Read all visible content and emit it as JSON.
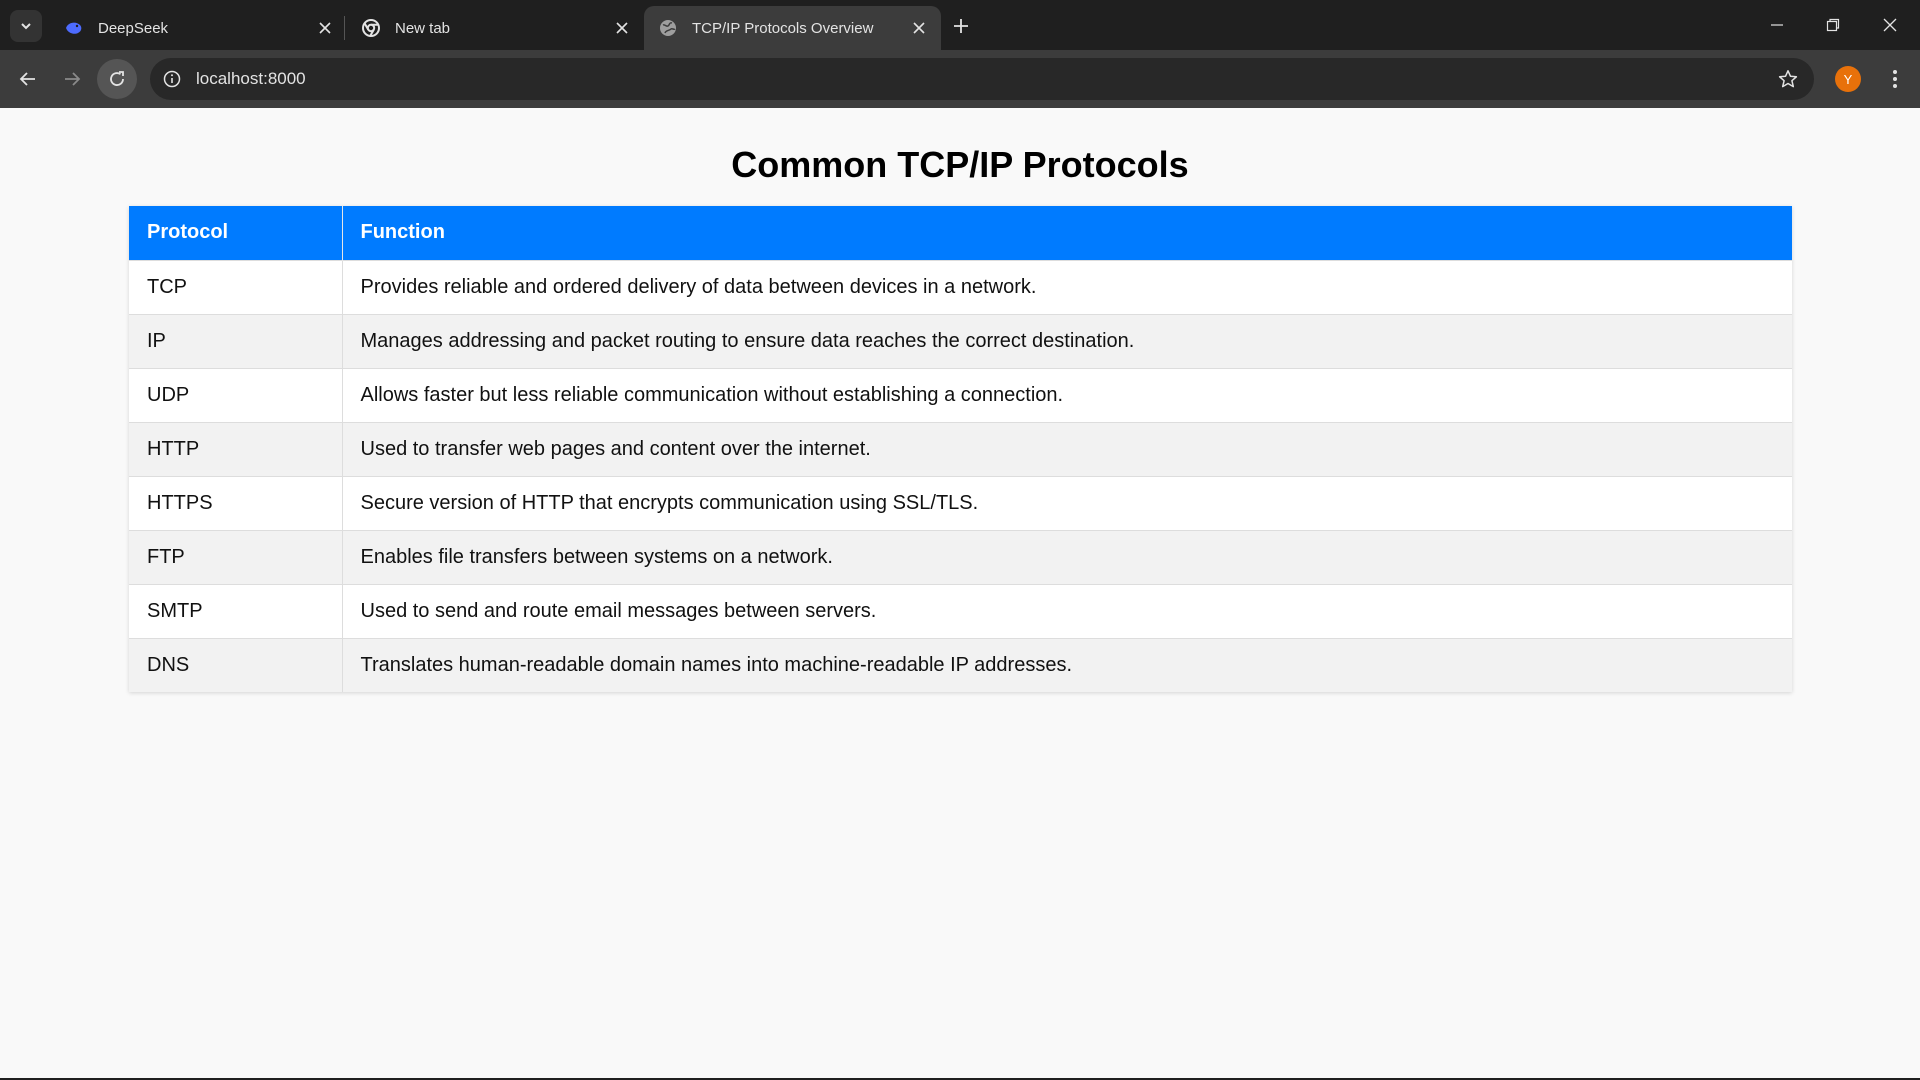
{
  "browser": {
    "tabs": [
      {
        "title": "DeepSeek",
        "favicon": "deepseek-whale-icon"
      },
      {
        "title": "New tab",
        "favicon": "chrome-icon"
      },
      {
        "title": "TCP/IP Protocols Overview",
        "favicon": "globe-icon",
        "active": true
      }
    ],
    "url": "localhost:8000",
    "profile_initial": "Y",
    "colors": {
      "profile": "#e8710a",
      "tabbar": "#1f1f1f",
      "toolbar": "#3c3c3c"
    }
  },
  "page": {
    "title": "Common TCP/IP Protocols",
    "table": {
      "headers": [
        "Protocol",
        "Function"
      ],
      "rows": [
        [
          "TCP",
          "Provides reliable and ordered delivery of data between devices in a network."
        ],
        [
          "IP",
          "Manages addressing and packet routing to ensure data reaches the correct destination."
        ],
        [
          "UDP",
          "Allows faster but less reliable communication without establishing a connection."
        ],
        [
          "HTTP",
          "Used to transfer web pages and content over the internet."
        ],
        [
          "HTTPS",
          "Secure version of HTTP that encrypts communication using SSL/TLS."
        ],
        [
          "FTP",
          "Enables file transfers between systems on a network."
        ],
        [
          "SMTP",
          "Used to send and route email messages between servers."
        ],
        [
          "DNS",
          "Translates human-readable domain names into machine-readable IP addresses."
        ]
      ]
    },
    "colors": {
      "header_bg": "#007bff",
      "page_bg": "#f9f9f9",
      "row_alt": "#f2f2f2"
    }
  }
}
